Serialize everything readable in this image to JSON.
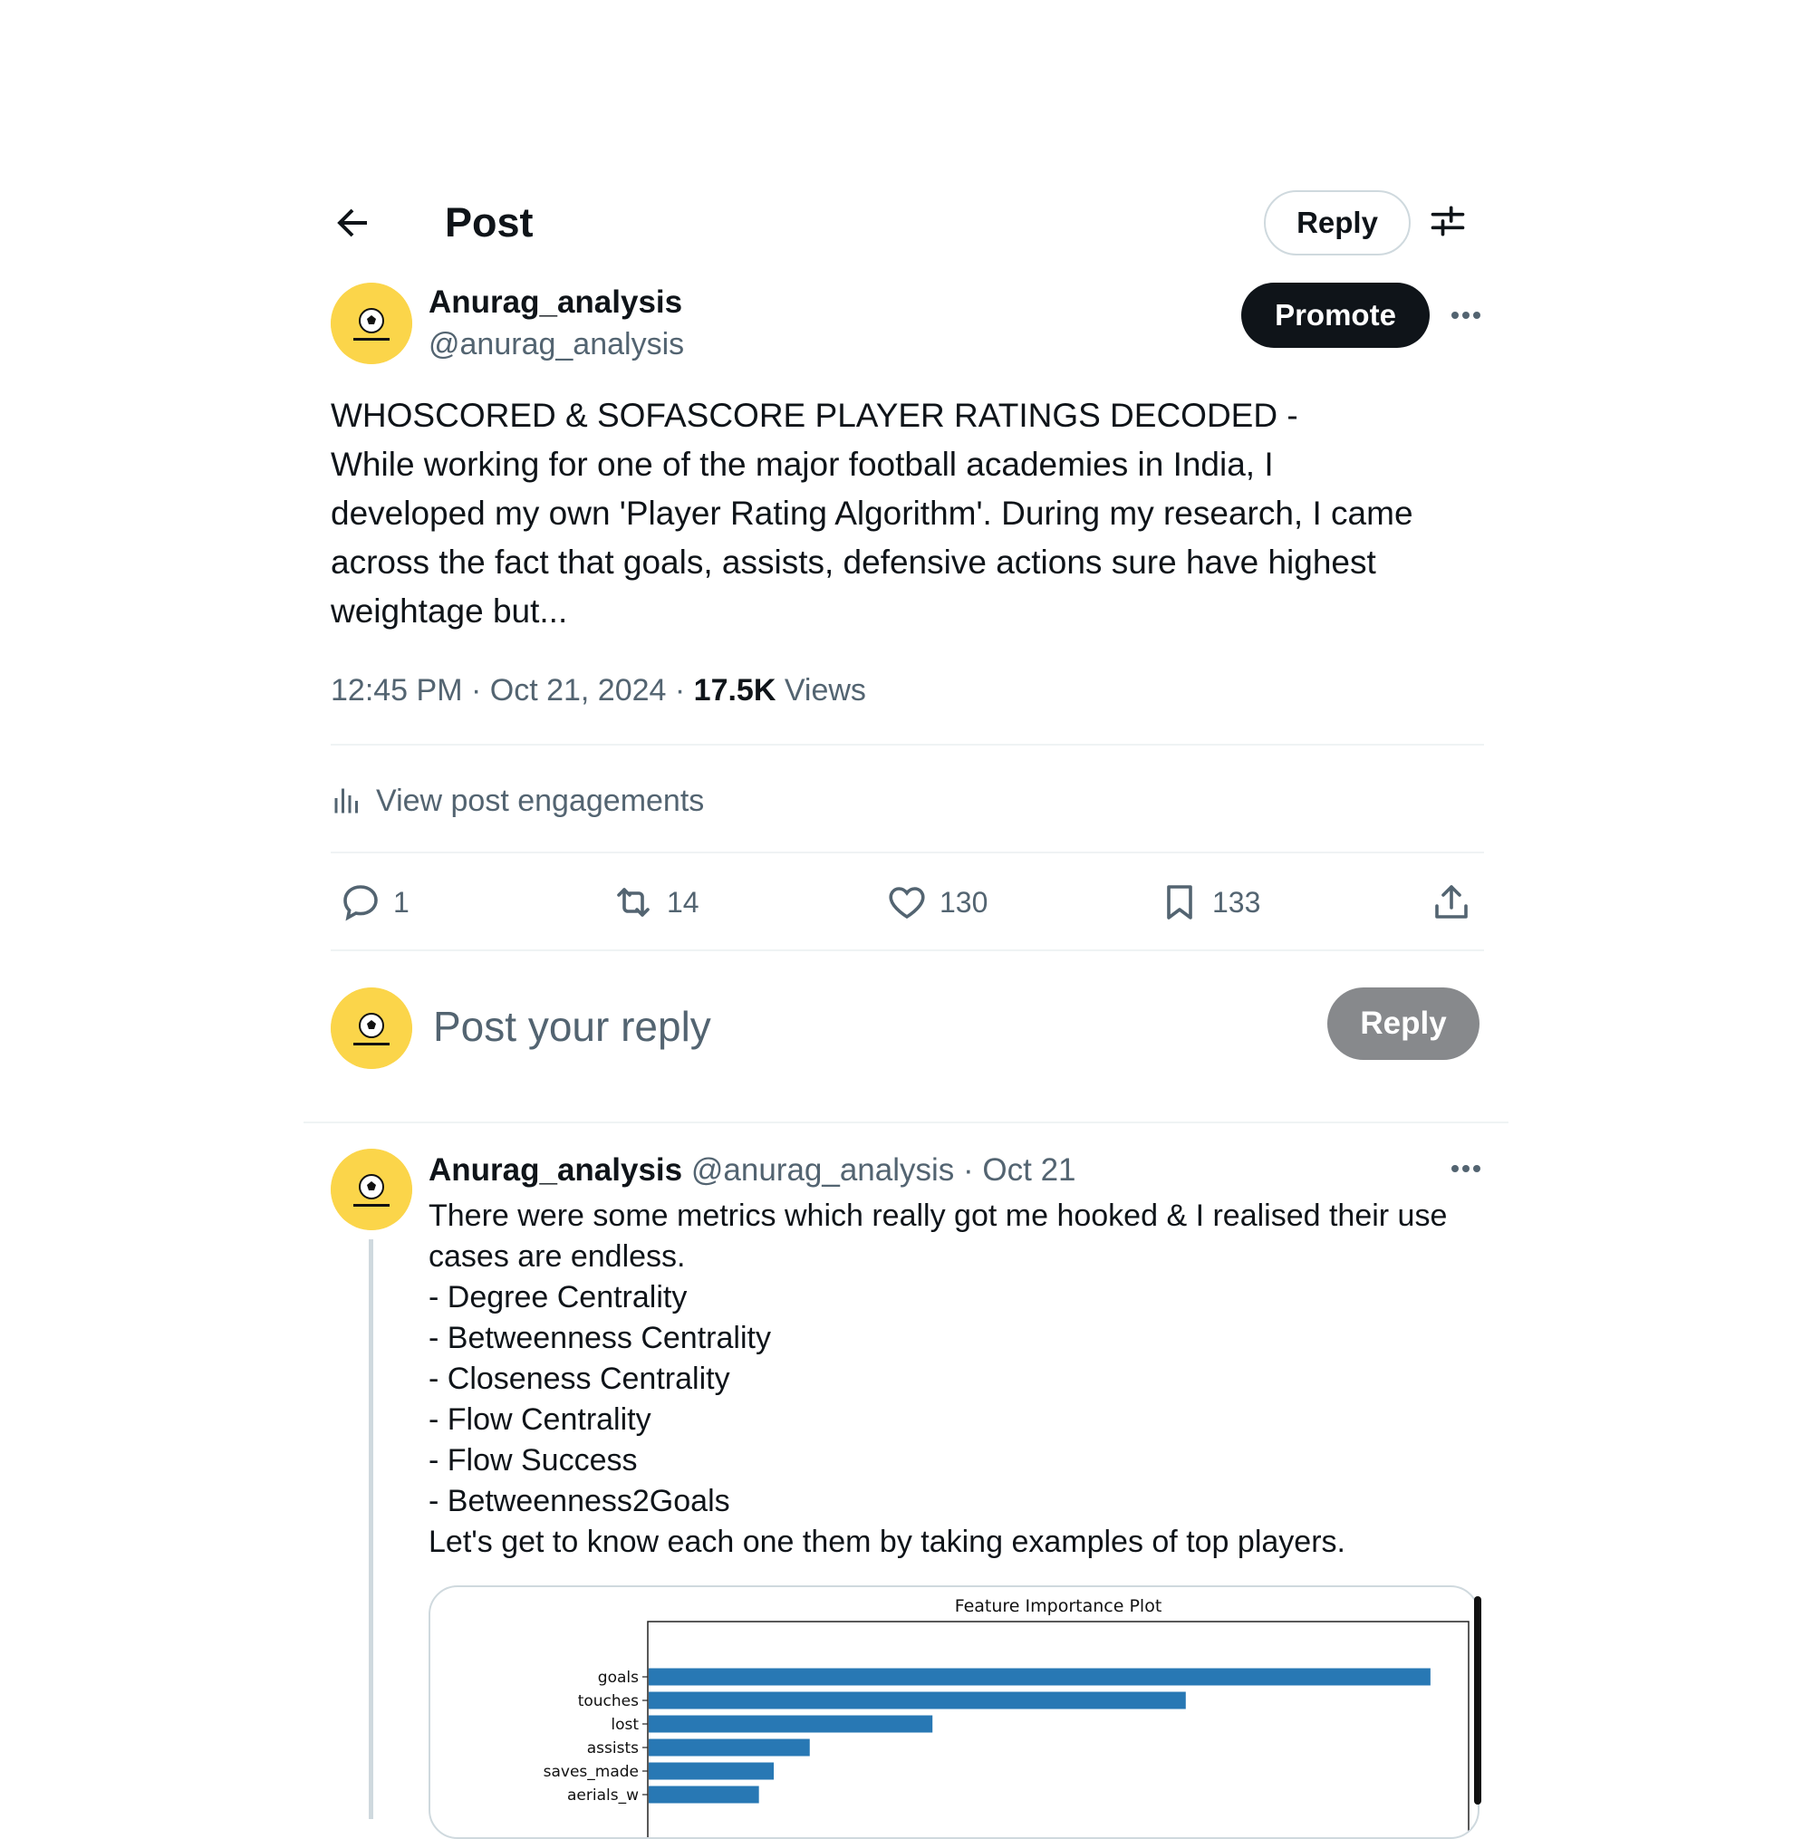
{
  "header": {
    "title": "Post",
    "reply_label": "Reply"
  },
  "post": {
    "author_name": "Anurag_analysis",
    "author_handle": "@anurag_analysis",
    "promote_label": "Promote",
    "text_lines": [
      "WHOSCORED & SOFASCORE PLAYER RATINGS DECODED -",
      "While working for one of the major football academies in India, I",
      "developed my own 'Player Rating Algorithm'. During my research, I came",
      "across the fact that goals, assists, defensive actions sure have highest",
      "weightage but..."
    ],
    "time": "12:45 PM",
    "date": "Oct 21, 2024",
    "views_count": "17.5K",
    "views_label": "Views",
    "engagements_label": "View post engagements"
  },
  "actions": {
    "replies": "1",
    "reposts": "14",
    "likes": "130",
    "bookmarks": "133"
  },
  "composer": {
    "placeholder": "Post your reply",
    "submit_label": "Reply"
  },
  "thread": {
    "author_name": "Anurag_analysis",
    "author_handle": "@anurag_analysis",
    "date": "Oct 21",
    "text_lines": [
      "There were some metrics which really got me hooked & I realised their use",
      "cases are endless.",
      "- Degree Centrality",
      "- Betweenness Centrality",
      "- Closeness Centrality",
      "- Flow Centrality",
      "- Flow Success",
      "- Betweenness2Goals",
      "Let's get to know each one them by taking examples of top players."
    ]
  },
  "colors": {
    "avatar_bg": "#fbd54a",
    "bar": "#2878b4",
    "muted": "#536471",
    "promote_bg": "#0f1419",
    "reply_disabled_bg": "#87898c"
  },
  "chart_data": {
    "type": "bar",
    "orientation": "horizontal",
    "title": "Feature Importance Plot",
    "categories": [
      "goals",
      "touches",
      "lost",
      "assists",
      "saves_made",
      "aerials_w"
    ],
    "values": [
      1.0,
      0.687,
      0.363,
      0.206,
      0.16,
      0.141
    ],
    "xlabel": "",
    "ylabel": "",
    "xlim": [
      0,
      1.05
    ],
    "grid": false
  }
}
